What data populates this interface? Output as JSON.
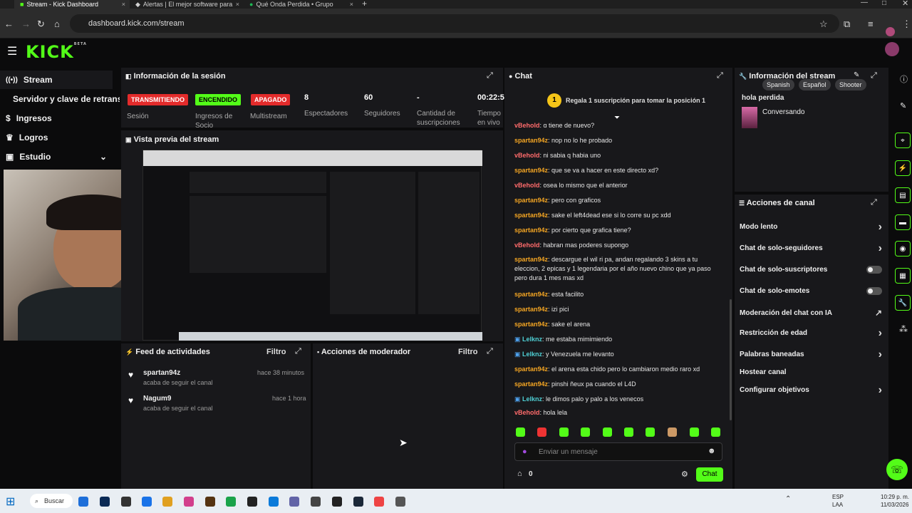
{
  "browser": {
    "tabs": [
      {
        "label": "Stream - Kick Dashboard",
        "active": true
      },
      {
        "label": "Alertas | El mejor software para",
        "active": false
      },
      {
        "label": "Qué Onda Perdida • Grupo",
        "active": false
      }
    ],
    "url": "dashboard.kick.com/stream"
  },
  "app": {
    "logo": "KICK",
    "logo_badge": "BETA",
    "sidebar": {
      "items": [
        {
          "label": "Stream",
          "icon": "stream-icon"
        },
        {
          "label": "Servidor y clave de retransmisión",
          "icon": ""
        },
        {
          "label": "Ingresos",
          "icon": "money-icon"
        },
        {
          "label": "Logros",
          "icon": "trophy-icon"
        },
        {
          "label": "Estudio",
          "icon": "studio-icon"
        }
      ]
    },
    "session": {
      "title": "Información de la sesión",
      "badges": [
        {
          "label": "TRANSMITIENDO",
          "color": "#e32b2b"
        },
        {
          "label": "ENCENDIDO",
          "color": "#53fc18"
        },
        {
          "label": "APAGADO",
          "color": "#e32b2b"
        }
      ],
      "badge_labels": [
        "Sesión",
        "Ingresos de Socio",
        "Multistream"
      ],
      "stats": [
        {
          "value": "8",
          "label": "Espectadores"
        },
        {
          "value": "60",
          "label": "Seguidores"
        },
        {
          "value": "-",
          "label": "Cantidad de suscripciones"
        },
        {
          "value": "00:22:5",
          "label": "Tiempo en vivo"
        }
      ]
    },
    "preview": {
      "title": "Vista previa del stream"
    },
    "activity": {
      "title": "Feed de actividades",
      "filter": "Filtro",
      "items": [
        {
          "user": "spartan94z",
          "text": "acaba de seguir el canal",
          "time": "hace 38 minutos"
        },
        {
          "user": "Nagum9",
          "text": "acaba de seguir el canal",
          "time": "hace 1 hora"
        }
      ]
    },
    "moderator": {
      "title": "Acciones de moderador",
      "filter": "Filtro"
    },
    "chat": {
      "title": "Chat",
      "gift_banner": "Regala 1 suscripción para tomar la posición 1",
      "gift_rank": "1",
      "messages": [
        {
          "user": "vBehold",
          "text": "q tiene de nuevo?",
          "color": "red"
        },
        {
          "user": "spartan94z",
          "text": "nop no lo he probado",
          "color": "orange"
        },
        {
          "user": "vBehold",
          "text": "ni sabia q habia uno",
          "color": "red"
        },
        {
          "user": "spartan94z",
          "text": "que se va a hacer en este directo xd?",
          "color": "orange"
        },
        {
          "user": "vBehold",
          "text": "osea lo mismo que el anterior",
          "color": "red"
        },
        {
          "user": "spartan94z",
          "text": "pero con graficos",
          "color": "orange"
        },
        {
          "user": "spartan94z",
          "text": "sake el left4dead ese si lo corre su pc xdd",
          "color": "orange"
        },
        {
          "user": "spartan94z",
          "text": "por cierto que grafica tiene?",
          "color": "orange"
        },
        {
          "user": "vBehold",
          "text": "habran mas poderes supongo",
          "color": "red"
        },
        {
          "user": "spartan94z",
          "text": "descargue el wil ri pa, andan regalando 3 skins a tu eleccion, 2 epicas y 1 legendaria por el año nuevo chino que ya paso pero dura 1 mes mas xd",
          "color": "orange"
        },
        {
          "user": "spartan94z",
          "text": "esta facilito",
          "color": "orange"
        },
        {
          "user": "spartan94z",
          "text": "izi pici",
          "color": "orange"
        },
        {
          "user": "spartan94z",
          "text": "sake el arena",
          "color": "orange"
        },
        {
          "user": "Lelknz",
          "text": "me estaba mimimiendo",
          "color": "cyan"
        },
        {
          "user": "Lelknz",
          "text": "y Venezuela me levanto",
          "color": "cyan"
        },
        {
          "user": "spartan94z",
          "text": "el arena esta chido pero lo cambiaron medio raro xd",
          "color": "orange"
        },
        {
          "user": "spartan94z",
          "text": "pinshi ñeux pa cuando el L4D",
          "color": "orange"
        },
        {
          "user": "Lelknz",
          "text": "le dimos palo y palo a los venecos",
          "color": "cyan"
        },
        {
          "user": "vBehold",
          "text": "hola lela",
          "color": "red"
        }
      ],
      "input_placeholder": "Enviar un mensaje",
      "points": "0",
      "send_label": "Chat"
    },
    "stream_info": {
      "title": "Información del stream",
      "stream_title": "hola perdida",
      "category": "Conversando",
      "tags": [
        "Spanish",
        "Español",
        "Shooter"
      ]
    },
    "channel_actions": {
      "title": "Acciones de canal",
      "items": [
        {
          "label": "Modo lento",
          "control": "chevron"
        },
        {
          "label": "Chat de solo-seguidores",
          "control": "chevron"
        },
        {
          "label": "Chat de solo-suscriptores",
          "control": "toggle"
        },
        {
          "label": "Chat de solo-emotes",
          "control": "toggle"
        },
        {
          "label": "Moderación del chat con IA",
          "control": "external"
        },
        {
          "label": "Restricción de edad",
          "control": "chevron"
        },
        {
          "label": "Palabras baneadas",
          "control": "chevron"
        },
        {
          "label": "Hostear canal",
          "control": "none"
        },
        {
          "label": "Configurar objetivos",
          "control": "chevron"
        }
      ]
    }
  },
  "taskbar": {
    "search_label": "Buscar",
    "lang": "ESP",
    "lang2": "LAA",
    "time": "10:29 p. m.",
    "date": "11/03/2026"
  },
  "colors": {
    "accent": "#53fc18",
    "panel": "#18181b",
    "bg": "#0b0b0c"
  }
}
